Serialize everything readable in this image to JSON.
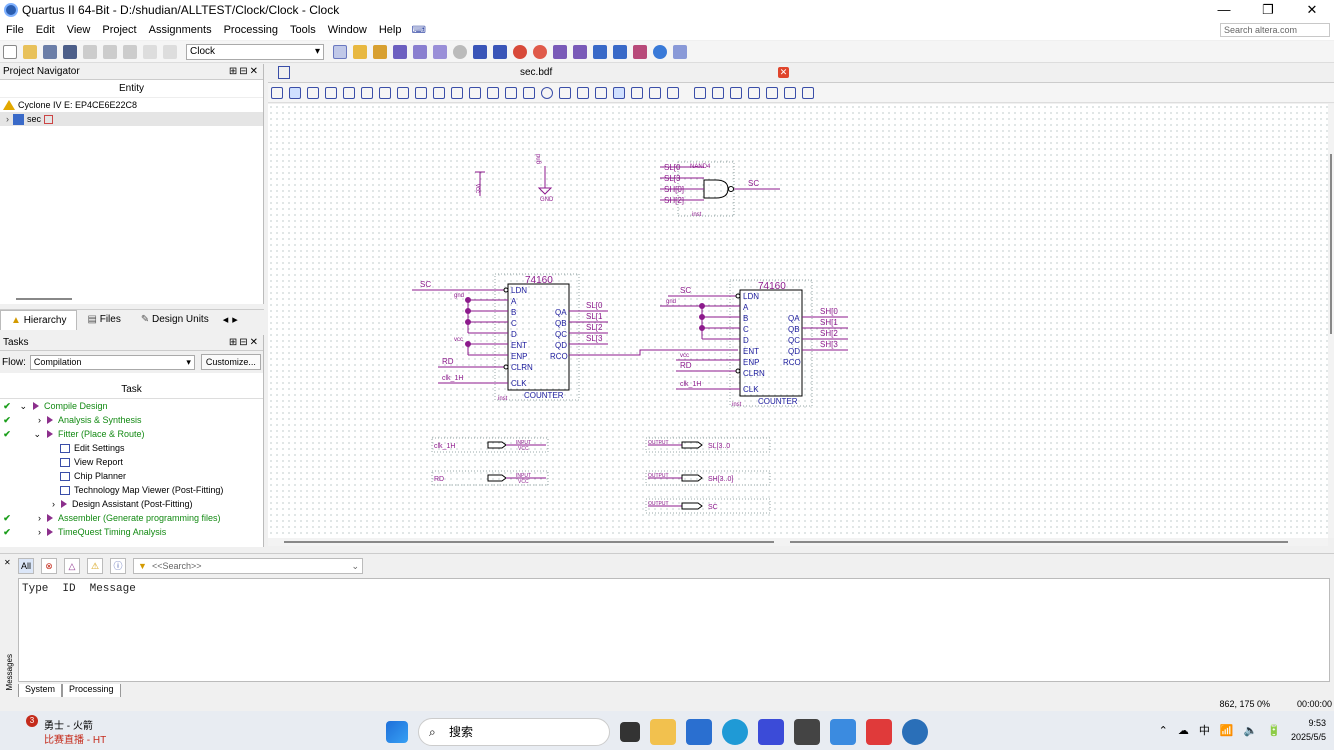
{
  "window": {
    "title": "Quartus II 64-Bit - D:/shudian/ALLTEST/Clock/Clock - Clock",
    "controls": [
      "—",
      "❐",
      "✕"
    ]
  },
  "menu": {
    "items": [
      "File",
      "Edit",
      "View",
      "Project",
      "Assignments",
      "Processing",
      "Tools",
      "Window",
      "Help"
    ],
    "search_placeholder": "Search altera.com"
  },
  "toolbar": {
    "revision_value": "Clock"
  },
  "project_navigator": {
    "title": "Project Navigator",
    "column_header": "Entity",
    "device": "Cyclone IV E: EP4CE6E22C8",
    "top_entity": "sec",
    "tabs": [
      "Hierarchy",
      "Files",
      "Design Units"
    ]
  },
  "tasks": {
    "title": "Tasks",
    "flow_label": "Flow:",
    "flow_value": "Compilation",
    "customize_label": "Customize...",
    "column_header": "Task",
    "rows": [
      {
        "label": "Compile Design",
        "check": true,
        "indent": 1,
        "expander": "⌄",
        "run": true,
        "green": true
      },
      {
        "label": "Analysis & Synthesis",
        "check": true,
        "indent": 2,
        "expander": "›",
        "run": true,
        "green": true
      },
      {
        "label": "Fitter (Place & Route)",
        "check": true,
        "indent": 2,
        "expander": "⌄",
        "run": true,
        "green": true
      },
      {
        "label": "Edit Settings",
        "check": false,
        "indent": 3,
        "expander": "",
        "run": false,
        "green": false
      },
      {
        "label": "View Report",
        "check": false,
        "indent": 3,
        "expander": "",
        "run": false,
        "green": false
      },
      {
        "label": "Chip Planner",
        "check": false,
        "indent": 3,
        "expander": "",
        "run": false,
        "green": false
      },
      {
        "label": "Technology Map Viewer (Post-Fitting)",
        "check": false,
        "indent": 3,
        "expander": "",
        "run": false,
        "green": false
      },
      {
        "label": "Design Assistant (Post-Fitting)",
        "check": false,
        "indent": 3,
        "expander": "›",
        "run": true,
        "green": false
      },
      {
        "label": "Assembler (Generate programming files)",
        "check": true,
        "indent": 2,
        "expander": "›",
        "run": true,
        "green": true
      },
      {
        "label": "TimeQuest Timing Analysis",
        "check": true,
        "indent": 2,
        "expander": "›",
        "run": true,
        "green": true
      }
    ]
  },
  "editor": {
    "tab_name": "sec.bdf"
  },
  "schematic": {
    "vcc": "vcc",
    "gnd_pin": "gnd",
    "gnd_label": "GND",
    "nand_label": "NAND4",
    "nand_inst": "inst",
    "nand_inputs": [
      "SL[0",
      "SL[3",
      "SH[0]",
      "SH[2]"
    ],
    "nand_output": "SC",
    "counter1": {
      "title": "74160",
      "pins_left": [
        "LDN",
        "A",
        "B",
        "C",
        "D",
        "ENT",
        "ENP",
        "CLRN",
        "CLK"
      ],
      "pins_right": [
        "QA",
        "QB",
        "QC",
        "QD",
        "RCO"
      ],
      "outputs": [
        "SL[0",
        "SL[1",
        "SL[2",
        "SL[3"
      ],
      "inputs": {
        "ldn": "SC",
        "a": "gnd",
        "ent": "vcc",
        "clrn": "RD",
        "clk": "clk_1H"
      },
      "inst": "inst",
      "footer": "COUNTER"
    },
    "counter2": {
      "title": "74160",
      "pins_left": [
        "LDN",
        "A",
        "B",
        "C",
        "D",
        "ENT",
        "ENP",
        "CLRN",
        "CLK"
      ],
      "pins_right": [
        "QA",
        "QB",
        "QC",
        "QD",
        "RCO"
      ],
      "outputs": [
        "SH[0",
        "SH[1",
        "SH[2",
        "SH[3"
      ],
      "inputs": {
        "ldn": "SC",
        "a": "gnd",
        "ent": "vcc",
        "clrn": "RD",
        "clk": "clk_1H"
      },
      "inst": "inst",
      "footer": "COUNTER"
    },
    "input_pins": [
      {
        "name": "clk_1H",
        "tag": "INPUT",
        "sub": "VCC"
      },
      {
        "name": "RD",
        "tag": "INPUT",
        "sub": "VCC"
      }
    ],
    "output_pins": [
      {
        "name": "SL[3..0",
        "tag": "OUTPUT"
      },
      {
        "name": "SH[3..0]",
        "tag": "OUTPUT"
      },
      {
        "name": "SC",
        "tag": "OUTPUT"
      }
    ]
  },
  "messages": {
    "filter_all": "All",
    "search_placeholder": "<<Search>>",
    "columns": [
      "Type",
      "ID",
      "Message"
    ],
    "tabs": [
      "System",
      "Processing"
    ],
    "side_label": "Messages"
  },
  "status": {
    "zoom": "862, 175  0%",
    "time": "00:00:00"
  },
  "taskbar": {
    "notif_badge": "3",
    "notif_line1": "勇士 - 火箭",
    "notif_line2": "比赛直播 - HT",
    "search_text": "搜索",
    "ime": "中",
    "clock_time": "9:53",
    "clock_date": "2025/5/5"
  }
}
